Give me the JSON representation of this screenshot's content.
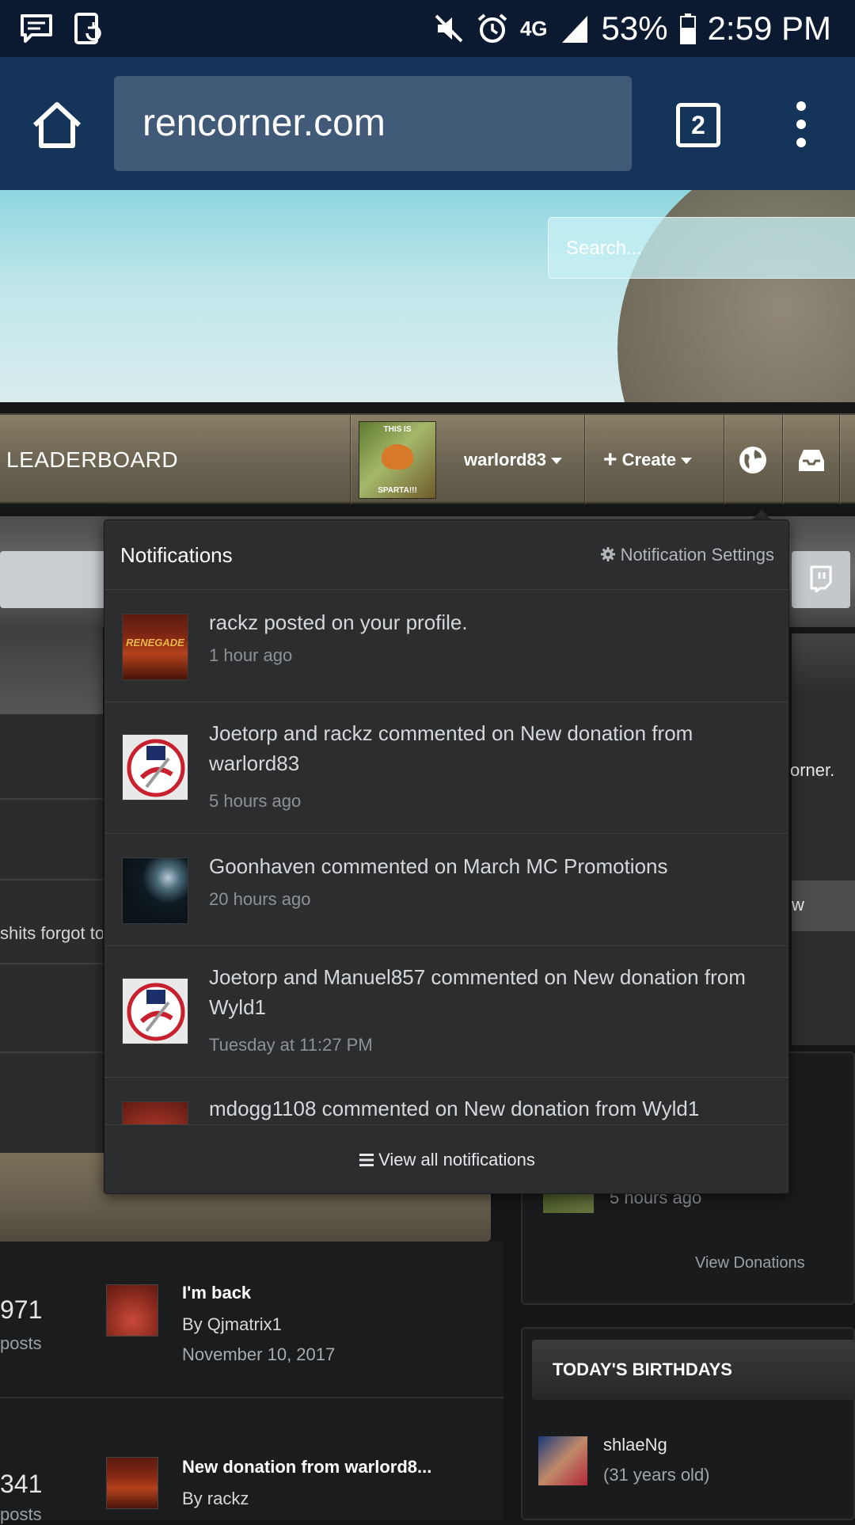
{
  "status_bar": {
    "battery": "53%",
    "time": "2:59 PM",
    "network": "4G"
  },
  "browser": {
    "url": "rencorner.com",
    "tab_count": "2"
  },
  "hero": {
    "search_placeholder": "Search..."
  },
  "nav": {
    "leaderboard": "LEADERBOARD",
    "avatar_top": "THIS IS",
    "avatar_bottom": "SPARTA!!!",
    "username": "warlord83",
    "create": "Create"
  },
  "notifications": {
    "title": "Notifications",
    "settings": "Notification Settings",
    "items": [
      {
        "text": "rackz posted on your profile.",
        "time": "1 hour ago"
      },
      {
        "text": "Joetorp and rackz commented on New donation from warlord83",
        "time": "5 hours ago"
      },
      {
        "text": "Goonhaven commented on March MC Promotions",
        "time": "20 hours ago"
      },
      {
        "text": "Joetorp and Manuel857 commented on New donation from Wyld1",
        "time": "Tuesday at 11:27 PM"
      },
      {
        "text": "mdogg1108 commented on New donation from Wyld1",
        "time": ""
      }
    ],
    "view_all": "View all notifications"
  },
  "background": {
    "snippet_left": "shits forgot to",
    "snippet_right1": "orner.",
    "snippet_right2": "w",
    "feed": [
      {
        "count": "971",
        "label": "posts",
        "title": "I'm back",
        "by": "By Qjmatrix1",
        "date": "November 10, 2017"
      },
      {
        "count": "341",
        "label": "posts",
        "title": "New donation from warlord8...",
        "by": "By rackz",
        "date": ""
      }
    ],
    "donation_time": "5 hours ago",
    "view_donations": "View Donations",
    "birthdays_title": "TODAY'S BIRTHDAYS",
    "birthday_name": "shlaeNg",
    "birthday_age": "(31 years old)"
  },
  "icon_names": [
    "message-icon",
    "screen-rotate-icon",
    "mute-icon",
    "alarm-icon",
    "signal-icon",
    "battery-icon",
    "home-icon",
    "menu-dots-icon",
    "globe-icon",
    "inbox-icon",
    "gear-icon",
    "twitch-icon",
    "list-icon"
  ]
}
